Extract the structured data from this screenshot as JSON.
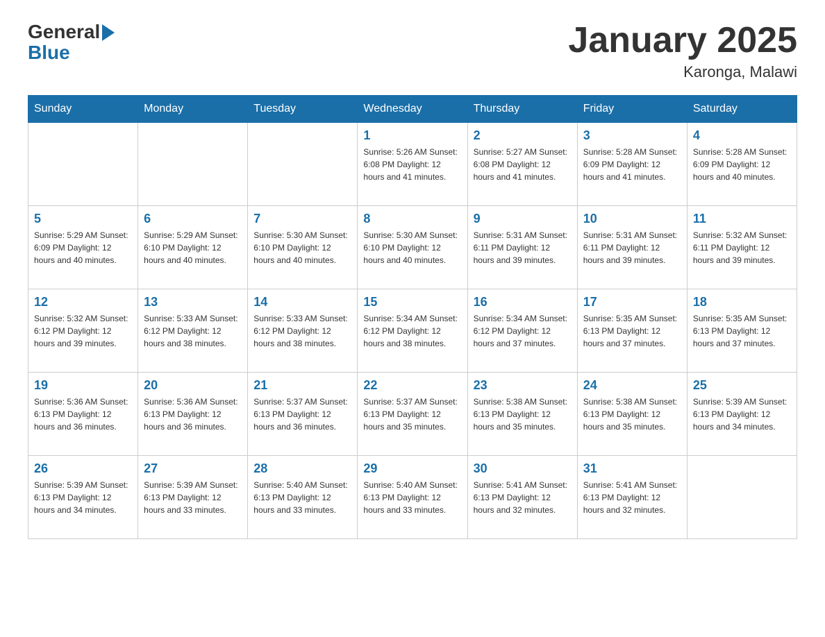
{
  "header": {
    "title": "January 2025",
    "subtitle": "Karonga, Malawi"
  },
  "logo": {
    "general": "General",
    "blue": "Blue"
  },
  "days_of_week": [
    "Sunday",
    "Monday",
    "Tuesday",
    "Wednesday",
    "Thursday",
    "Friday",
    "Saturday"
  ],
  "weeks": [
    {
      "cells": [
        {
          "day": "",
          "info": ""
        },
        {
          "day": "",
          "info": ""
        },
        {
          "day": "",
          "info": ""
        },
        {
          "day": "1",
          "info": "Sunrise: 5:26 AM\nSunset: 6:08 PM\nDaylight: 12 hours\nand 41 minutes."
        },
        {
          "day": "2",
          "info": "Sunrise: 5:27 AM\nSunset: 6:08 PM\nDaylight: 12 hours\nand 41 minutes."
        },
        {
          "day": "3",
          "info": "Sunrise: 5:28 AM\nSunset: 6:09 PM\nDaylight: 12 hours\nand 41 minutes."
        },
        {
          "day": "4",
          "info": "Sunrise: 5:28 AM\nSunset: 6:09 PM\nDaylight: 12 hours\nand 40 minutes."
        }
      ]
    },
    {
      "cells": [
        {
          "day": "5",
          "info": "Sunrise: 5:29 AM\nSunset: 6:09 PM\nDaylight: 12 hours\nand 40 minutes."
        },
        {
          "day": "6",
          "info": "Sunrise: 5:29 AM\nSunset: 6:10 PM\nDaylight: 12 hours\nand 40 minutes."
        },
        {
          "day": "7",
          "info": "Sunrise: 5:30 AM\nSunset: 6:10 PM\nDaylight: 12 hours\nand 40 minutes."
        },
        {
          "day": "8",
          "info": "Sunrise: 5:30 AM\nSunset: 6:10 PM\nDaylight: 12 hours\nand 40 minutes."
        },
        {
          "day": "9",
          "info": "Sunrise: 5:31 AM\nSunset: 6:11 PM\nDaylight: 12 hours\nand 39 minutes."
        },
        {
          "day": "10",
          "info": "Sunrise: 5:31 AM\nSunset: 6:11 PM\nDaylight: 12 hours\nand 39 minutes."
        },
        {
          "day": "11",
          "info": "Sunrise: 5:32 AM\nSunset: 6:11 PM\nDaylight: 12 hours\nand 39 minutes."
        }
      ]
    },
    {
      "cells": [
        {
          "day": "12",
          "info": "Sunrise: 5:32 AM\nSunset: 6:12 PM\nDaylight: 12 hours\nand 39 minutes."
        },
        {
          "day": "13",
          "info": "Sunrise: 5:33 AM\nSunset: 6:12 PM\nDaylight: 12 hours\nand 38 minutes."
        },
        {
          "day": "14",
          "info": "Sunrise: 5:33 AM\nSunset: 6:12 PM\nDaylight: 12 hours\nand 38 minutes."
        },
        {
          "day": "15",
          "info": "Sunrise: 5:34 AM\nSunset: 6:12 PM\nDaylight: 12 hours\nand 38 minutes."
        },
        {
          "day": "16",
          "info": "Sunrise: 5:34 AM\nSunset: 6:12 PM\nDaylight: 12 hours\nand 37 minutes."
        },
        {
          "day": "17",
          "info": "Sunrise: 5:35 AM\nSunset: 6:13 PM\nDaylight: 12 hours\nand 37 minutes."
        },
        {
          "day": "18",
          "info": "Sunrise: 5:35 AM\nSunset: 6:13 PM\nDaylight: 12 hours\nand 37 minutes."
        }
      ]
    },
    {
      "cells": [
        {
          "day": "19",
          "info": "Sunrise: 5:36 AM\nSunset: 6:13 PM\nDaylight: 12 hours\nand 36 minutes."
        },
        {
          "day": "20",
          "info": "Sunrise: 5:36 AM\nSunset: 6:13 PM\nDaylight: 12 hours\nand 36 minutes."
        },
        {
          "day": "21",
          "info": "Sunrise: 5:37 AM\nSunset: 6:13 PM\nDaylight: 12 hours\nand 36 minutes."
        },
        {
          "day": "22",
          "info": "Sunrise: 5:37 AM\nSunset: 6:13 PM\nDaylight: 12 hours\nand 35 minutes."
        },
        {
          "day": "23",
          "info": "Sunrise: 5:38 AM\nSunset: 6:13 PM\nDaylight: 12 hours\nand 35 minutes."
        },
        {
          "day": "24",
          "info": "Sunrise: 5:38 AM\nSunset: 6:13 PM\nDaylight: 12 hours\nand 35 minutes."
        },
        {
          "day": "25",
          "info": "Sunrise: 5:39 AM\nSunset: 6:13 PM\nDaylight: 12 hours\nand 34 minutes."
        }
      ]
    },
    {
      "cells": [
        {
          "day": "26",
          "info": "Sunrise: 5:39 AM\nSunset: 6:13 PM\nDaylight: 12 hours\nand 34 minutes."
        },
        {
          "day": "27",
          "info": "Sunrise: 5:39 AM\nSunset: 6:13 PM\nDaylight: 12 hours\nand 33 minutes."
        },
        {
          "day": "28",
          "info": "Sunrise: 5:40 AM\nSunset: 6:13 PM\nDaylight: 12 hours\nand 33 minutes."
        },
        {
          "day": "29",
          "info": "Sunrise: 5:40 AM\nSunset: 6:13 PM\nDaylight: 12 hours\nand 33 minutes."
        },
        {
          "day": "30",
          "info": "Sunrise: 5:41 AM\nSunset: 6:13 PM\nDaylight: 12 hours\nand 32 minutes."
        },
        {
          "day": "31",
          "info": "Sunrise: 5:41 AM\nSunset: 6:13 PM\nDaylight: 12 hours\nand 32 minutes."
        },
        {
          "day": "",
          "info": ""
        }
      ]
    }
  ]
}
